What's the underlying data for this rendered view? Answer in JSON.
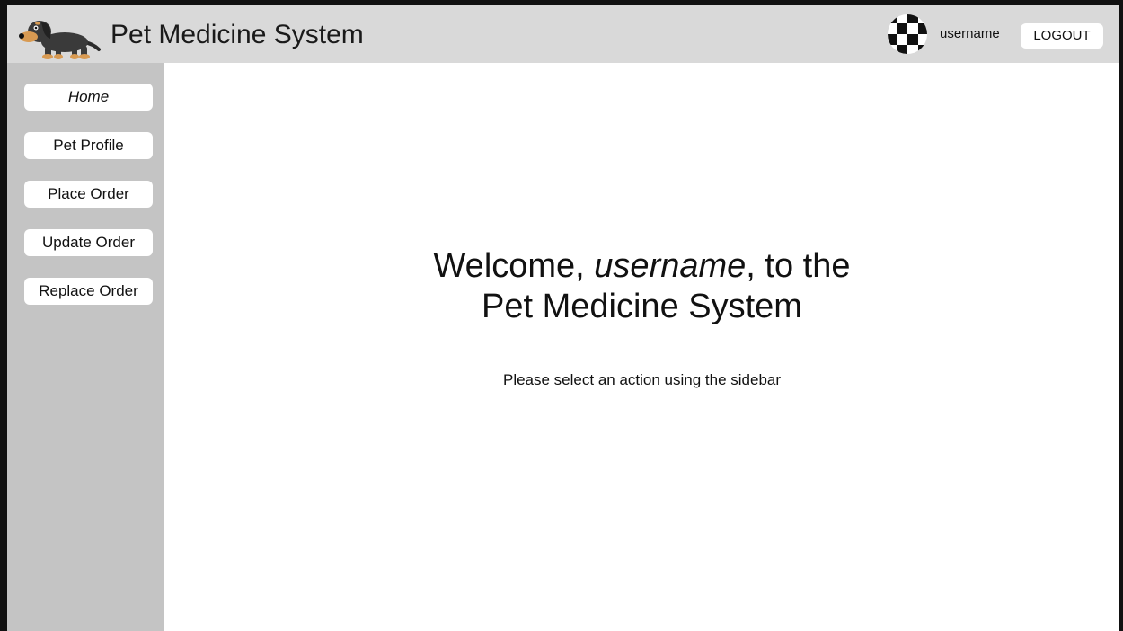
{
  "header": {
    "app_title": "Pet Medicine System",
    "logo_icon": "dachshund-dog-icon",
    "avatar_icon": "checkered-avatar-icon",
    "username": "username",
    "logout_label": "LOGOUT",
    "background": "#d9d9d9"
  },
  "sidebar": {
    "background": "#c4c4c4",
    "items": [
      {
        "label": "Home",
        "active": true
      },
      {
        "label": "Pet Profile"
      },
      {
        "label": "Place Order"
      },
      {
        "label": "Update Order"
      },
      {
        "label": "Replace Order"
      }
    ]
  },
  "main": {
    "welcome_prefix": "Welcome, ",
    "welcome_username": "username",
    "welcome_suffix": ", to the",
    "welcome_line2": "Pet Medicine System",
    "subtitle": "Please select an action using the sidebar"
  }
}
